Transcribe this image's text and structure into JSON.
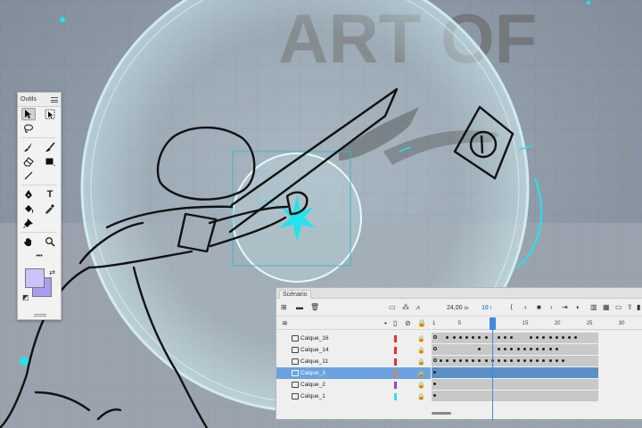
{
  "stage": {
    "background_lettering": "ART OF",
    "bubble_color": "#bfeaf0",
    "spark_color": "#22e3ef",
    "sketch_color": "#111111"
  },
  "tools_panel": {
    "title": "Outils",
    "tools": [
      [
        "selection-icon",
        "subselection-icon"
      ],
      [
        "lasso-icon"
      ],
      [
        "brush-icon",
        "paintbrush-icon"
      ],
      [
        "eraser-icon",
        "rectangle-icon"
      ],
      [
        "line-icon"
      ],
      [
        "pen-icon",
        "text-icon"
      ],
      [
        "paint-bucket-icon",
        "eyedropper-icon"
      ],
      [
        "pin-icon"
      ],
      [
        "hand-icon",
        "zoom-icon"
      ],
      [
        "more-icon"
      ]
    ],
    "text_tool_glyph": "T",
    "more_glyph": "•••",
    "stroke_color": "#c9c3f7",
    "fill_color": "#a79ef0"
  },
  "timeline": {
    "tab": "Scénario",
    "fps_value": "24,00",
    "fps_unit": "i/s",
    "current_frame": "10",
    "frame_unit": "i",
    "ruler_ticks": [
      "1",
      "5",
      "10",
      "15",
      "20",
      "25",
      "30"
    ],
    "playhead_frame": 10,
    "layers": [
      {
        "name": "Calque_16",
        "color": "#e8302a",
        "selected": false
      },
      {
        "name": "Calque_14",
        "color": "#e8302a",
        "selected": false
      },
      {
        "name": "Calque_11",
        "color": "#e8302a",
        "selected": false
      },
      {
        "name": "Calque_3",
        "color": "#ef7d2d",
        "selected": true
      },
      {
        "name": "Calque_2",
        "color": "#9b3fd4",
        "selected": false
      },
      {
        "name": "Calque_1",
        "color": "#2ee0ee",
        "selected": false
      }
    ],
    "colors": {
      "accent": "#3d8be0",
      "selected_row": "#6aa3df"
    }
  }
}
